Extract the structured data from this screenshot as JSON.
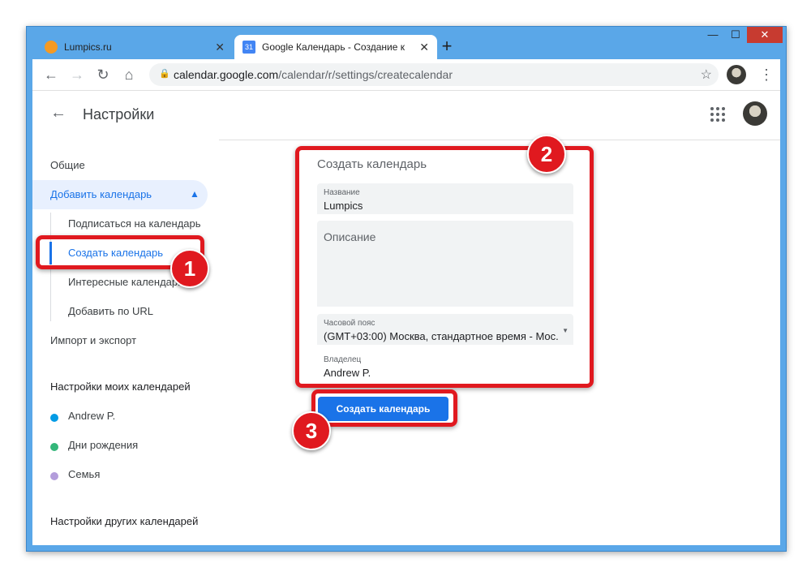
{
  "browser": {
    "tabs": [
      {
        "title": "Lumpics.ru",
        "favicon": "lumpics-favicon",
        "close": "✕"
      },
      {
        "title": "Google Календарь - Создание к",
        "favicon": "calendar-favicon",
        "favicon_text": "31",
        "close": "✕"
      }
    ],
    "new_tab": "+",
    "window_controls": {
      "minimize": "—",
      "maximize": "☐",
      "close": "✕"
    },
    "url_domain": "calendar.google.com",
    "url_path": "/calendar/r/settings/createcalendar"
  },
  "app": {
    "title": "Настройки"
  },
  "sidebar": {
    "general": "Общие",
    "add_calendar": "Добавить календарь",
    "sub_items": [
      "Подписаться на календарь",
      "Создать календарь",
      "Интересные календари",
      "Добавить по URL"
    ],
    "import_export": "Импорт и экспорт",
    "my_calendars_header": "Настройки моих календарей",
    "my_calendars": [
      {
        "name": "Andrew P.",
        "color": "#039be5"
      },
      {
        "name": "Дни рождения",
        "color": "#33b679"
      },
      {
        "name": "Семья",
        "color": "#b39ddb"
      }
    ],
    "other_calendars_header": "Настройки других календарей"
  },
  "form": {
    "title": "Создать календарь",
    "name_label": "Название",
    "name_value": "Lumpics",
    "description_placeholder": "Описание",
    "timezone_label": "Часовой пояс",
    "timezone_value": "(GMT+03:00) Москва, стандартное время - Мос...",
    "owner_label": "Владелец",
    "owner_value": "Andrew P.",
    "submit": "Создать календарь"
  },
  "annotations": [
    "1",
    "2",
    "3"
  ],
  "colors": {
    "accent": "#1a73e8",
    "highlight": "#e0191f",
    "titlebar": "#5aa7e8"
  }
}
